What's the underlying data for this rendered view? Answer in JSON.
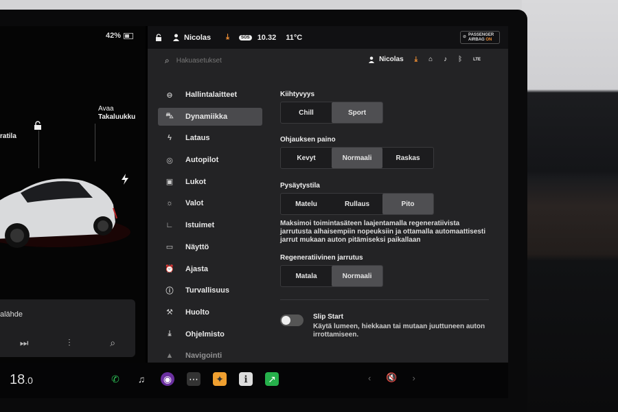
{
  "colors": {
    "accent": "#f29035",
    "selected": "#4f4f52",
    "phone": "#2fc558",
    "chart": "#26b04b"
  },
  "left": {
    "battery": "42%",
    "label_trunk_line1": "Avaa",
    "label_trunk_line2": "Takaluukku",
    "label_frunk": "ratila",
    "media_source": "alähde"
  },
  "topbar": {
    "user": "Nicolas",
    "sos": "SOS",
    "time": "10.32",
    "temp": "11°C",
    "airbag_line1": "PASSENGER",
    "airbag_line2": "AIRBAG",
    "airbag_state": "ON"
  },
  "search": {
    "placeholder": "Hakuasetukset"
  },
  "profile": {
    "user": "Nicolas",
    "signal": "LTE"
  },
  "menu": [
    {
      "label": "Hallintalaitteet",
      "icon": "toggle-icon"
    },
    {
      "label": "Dynamiikka",
      "icon": "car-icon"
    },
    {
      "label": "Lataus",
      "icon": "bolt-icon"
    },
    {
      "label": "Autopilot",
      "icon": "steering-wheel-icon"
    },
    {
      "label": "Lukot",
      "icon": "lock-icon"
    },
    {
      "label": "Valot",
      "icon": "light-icon"
    },
    {
      "label": "Istuimet",
      "icon": "seat-icon"
    },
    {
      "label": "Näyttö",
      "icon": "display-icon"
    },
    {
      "label": "Ajasta",
      "icon": "alarm-icon"
    },
    {
      "label": "Turvallisuus",
      "icon": "info-icon"
    },
    {
      "label": "Huolto",
      "icon": "wrench-icon"
    },
    {
      "label": "Ohjelmisto",
      "icon": "download-icon"
    },
    {
      "label": "Navigointi",
      "icon": "navigation-icon"
    }
  ],
  "dynamics": {
    "accel": {
      "title": "Kiihtyvyys",
      "options": [
        "Chill",
        "Sport"
      ],
      "selected": "Sport"
    },
    "steering": {
      "title": "Ohjauksen paino",
      "options": [
        "Kevyt",
        "Normaali",
        "Raskas"
      ],
      "selected": "Normaali"
    },
    "stop": {
      "title": "Pysäytystila",
      "options": [
        "Matelu",
        "Rullaus",
        "Pito"
      ],
      "selected": "Pito",
      "description": "Maksimoi toimintasäteen laajentamalla regeneratiivista jarrutusta alhaisempiin nopeuksiin ja ottamalla automaattisesti jarrut mukaan auton pitämiseksi paikallaan"
    },
    "regen": {
      "title": "Regeneratiivinen jarrutus",
      "options": [
        "Matala",
        "Normaali"
      ],
      "selected": "Normaali"
    },
    "slip": {
      "title": "Slip Start",
      "description": "Käytä lumeen, hiekkaan tai mutaan juuttuneen auton irrottamiseen.",
      "enabled": false
    }
  },
  "dock": {
    "temp_int": "18",
    "temp_dec": ".0"
  }
}
